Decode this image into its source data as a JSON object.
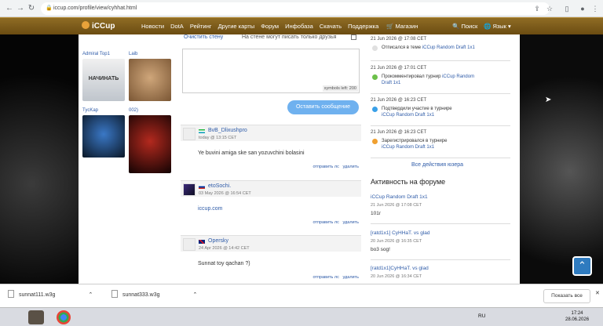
{
  "browser": {
    "url": "iccup.com/profile/view/cyhhat.html"
  },
  "site": {
    "logo": "iCCup",
    "menu": [
      "Новости",
      "DotA",
      "Рейтинг",
      "Другие карты",
      "Форум",
      "Инфобаза",
      "Скачать",
      "Поддержка"
    ],
    "shop": "Магазин",
    "search": "Поиск",
    "language": "Язык"
  },
  "friends": [
    {
      "name": "Admiral Top1",
      "avatar_text": "НАЧИНАТЬ"
    },
    {
      "name": "Laib"
    },
    {
      "name": "TycKap"
    },
    {
      "name": "002)"
    }
  ],
  "wall": {
    "clear_link": "Очистить стену",
    "note": "На стене могут писать только друзья",
    "symbols_left": "symbols left: 200",
    "send_button": "Оставить сообщение",
    "actions": {
      "reply": "отправить лс",
      "delete": "удалить"
    },
    "comments": [
      {
        "user": "BvB_Dlixushpro",
        "date": "today @ 13:15 CET",
        "text": "Ye buvini amiga ske san yozuvchini bolasini",
        "link": false
      },
      {
        "user": "etoSochi.",
        "date": "03 May 2026 @ 16:54 CET",
        "text": "iccup.com",
        "link": true
      },
      {
        "user": "Opersky",
        "date": "24 Apr 2026 @ 14:42 CET",
        "text": "Sunnat toy qachan ?)",
        "link": false
      }
    ]
  },
  "activity": [
    {
      "date": "21 Jun 2026 @ 17:08 CET",
      "text": "Отписался в теме",
      "link": "iCCup Random Draft 1x1"
    },
    {
      "date": "21 Jun 2026 @ 17:01 CET",
      "text": "Прокомментировал турнир",
      "link": "iCCup Random Draft 1x1"
    },
    {
      "date": "21 Jun 2026 @ 16:23 CET",
      "text": "Подтвердили участие в турнире",
      "link": "iCCup Random Draft 1x1"
    },
    {
      "date": "21 Jun 2026 @ 16:23 CET",
      "text": "Зарегистрировался в турнире",
      "link": "iCCup Random Draft 1x1"
    }
  ],
  "all_actions": "Все действия юзера",
  "forum": {
    "title": "Активность на форуме",
    "topics": [
      {
        "title": "iCCup Random Draft 1x1",
        "date": "21 Jun 2026 @ 17:08 CET",
        "text": "101г"
      },
      {
        "title": "[ratd1x1] CyHHaT. vs glad",
        "date": "20 Jun 2026 @ 16:35 CET",
        "text": "bo3 sog!"
      },
      {
        "title": "[ratd1x1]CyHHaT. vs glad",
        "date": "20 Jun 2026 @ 16:34 CET",
        "text": ""
      }
    ]
  },
  "downloads": [
    {
      "name": "sunnat111.w3g"
    },
    {
      "name": "sunnat333.w3g"
    }
  ],
  "downloads_show_all": "Показать все",
  "taskbar": {
    "lang": "RU",
    "time": "17:24",
    "date": "28.06.2026"
  }
}
